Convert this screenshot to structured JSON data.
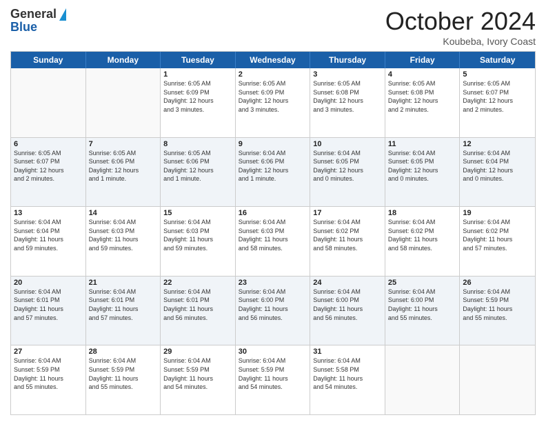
{
  "header": {
    "logo_general": "General",
    "logo_blue": "Blue",
    "month_title": "October 2024",
    "subtitle": "Koubeba, Ivory Coast"
  },
  "weekdays": [
    "Sunday",
    "Monday",
    "Tuesday",
    "Wednesday",
    "Thursday",
    "Friday",
    "Saturday"
  ],
  "rows": [
    {
      "cells": [
        {
          "day": "",
          "info": ""
        },
        {
          "day": "",
          "info": ""
        },
        {
          "day": "1",
          "info": "Sunrise: 6:05 AM\nSunset: 6:09 PM\nDaylight: 12 hours\nand 3 minutes."
        },
        {
          "day": "2",
          "info": "Sunrise: 6:05 AM\nSunset: 6:09 PM\nDaylight: 12 hours\nand 3 minutes."
        },
        {
          "day": "3",
          "info": "Sunrise: 6:05 AM\nSunset: 6:08 PM\nDaylight: 12 hours\nand 3 minutes."
        },
        {
          "day": "4",
          "info": "Sunrise: 6:05 AM\nSunset: 6:08 PM\nDaylight: 12 hours\nand 2 minutes."
        },
        {
          "day": "5",
          "info": "Sunrise: 6:05 AM\nSunset: 6:07 PM\nDaylight: 12 hours\nand 2 minutes."
        }
      ],
      "alt": false
    },
    {
      "cells": [
        {
          "day": "6",
          "info": "Sunrise: 6:05 AM\nSunset: 6:07 PM\nDaylight: 12 hours\nand 2 minutes."
        },
        {
          "day": "7",
          "info": "Sunrise: 6:05 AM\nSunset: 6:06 PM\nDaylight: 12 hours\nand 1 minute."
        },
        {
          "day": "8",
          "info": "Sunrise: 6:05 AM\nSunset: 6:06 PM\nDaylight: 12 hours\nand 1 minute."
        },
        {
          "day": "9",
          "info": "Sunrise: 6:04 AM\nSunset: 6:06 PM\nDaylight: 12 hours\nand 1 minute."
        },
        {
          "day": "10",
          "info": "Sunrise: 6:04 AM\nSunset: 6:05 PM\nDaylight: 12 hours\nand 0 minutes."
        },
        {
          "day": "11",
          "info": "Sunrise: 6:04 AM\nSunset: 6:05 PM\nDaylight: 12 hours\nand 0 minutes."
        },
        {
          "day": "12",
          "info": "Sunrise: 6:04 AM\nSunset: 6:04 PM\nDaylight: 12 hours\nand 0 minutes."
        }
      ],
      "alt": true
    },
    {
      "cells": [
        {
          "day": "13",
          "info": "Sunrise: 6:04 AM\nSunset: 6:04 PM\nDaylight: 11 hours\nand 59 minutes."
        },
        {
          "day": "14",
          "info": "Sunrise: 6:04 AM\nSunset: 6:03 PM\nDaylight: 11 hours\nand 59 minutes."
        },
        {
          "day": "15",
          "info": "Sunrise: 6:04 AM\nSunset: 6:03 PM\nDaylight: 11 hours\nand 59 minutes."
        },
        {
          "day": "16",
          "info": "Sunrise: 6:04 AM\nSunset: 6:03 PM\nDaylight: 11 hours\nand 58 minutes."
        },
        {
          "day": "17",
          "info": "Sunrise: 6:04 AM\nSunset: 6:02 PM\nDaylight: 11 hours\nand 58 minutes."
        },
        {
          "day": "18",
          "info": "Sunrise: 6:04 AM\nSunset: 6:02 PM\nDaylight: 11 hours\nand 58 minutes."
        },
        {
          "day": "19",
          "info": "Sunrise: 6:04 AM\nSunset: 6:02 PM\nDaylight: 11 hours\nand 57 minutes."
        }
      ],
      "alt": false
    },
    {
      "cells": [
        {
          "day": "20",
          "info": "Sunrise: 6:04 AM\nSunset: 6:01 PM\nDaylight: 11 hours\nand 57 minutes."
        },
        {
          "day": "21",
          "info": "Sunrise: 6:04 AM\nSunset: 6:01 PM\nDaylight: 11 hours\nand 57 minutes."
        },
        {
          "day": "22",
          "info": "Sunrise: 6:04 AM\nSunset: 6:01 PM\nDaylight: 11 hours\nand 56 minutes."
        },
        {
          "day": "23",
          "info": "Sunrise: 6:04 AM\nSunset: 6:00 PM\nDaylight: 11 hours\nand 56 minutes."
        },
        {
          "day": "24",
          "info": "Sunrise: 6:04 AM\nSunset: 6:00 PM\nDaylight: 11 hours\nand 56 minutes."
        },
        {
          "day": "25",
          "info": "Sunrise: 6:04 AM\nSunset: 6:00 PM\nDaylight: 11 hours\nand 55 minutes."
        },
        {
          "day": "26",
          "info": "Sunrise: 6:04 AM\nSunset: 5:59 PM\nDaylight: 11 hours\nand 55 minutes."
        }
      ],
      "alt": true
    },
    {
      "cells": [
        {
          "day": "27",
          "info": "Sunrise: 6:04 AM\nSunset: 5:59 PM\nDaylight: 11 hours\nand 55 minutes."
        },
        {
          "day": "28",
          "info": "Sunrise: 6:04 AM\nSunset: 5:59 PM\nDaylight: 11 hours\nand 55 minutes."
        },
        {
          "day": "29",
          "info": "Sunrise: 6:04 AM\nSunset: 5:59 PM\nDaylight: 11 hours\nand 54 minutes."
        },
        {
          "day": "30",
          "info": "Sunrise: 6:04 AM\nSunset: 5:59 PM\nDaylight: 11 hours\nand 54 minutes."
        },
        {
          "day": "31",
          "info": "Sunrise: 6:04 AM\nSunset: 5:58 PM\nDaylight: 11 hours\nand 54 minutes."
        },
        {
          "day": "",
          "info": ""
        },
        {
          "day": "",
          "info": ""
        }
      ],
      "alt": false
    }
  ]
}
